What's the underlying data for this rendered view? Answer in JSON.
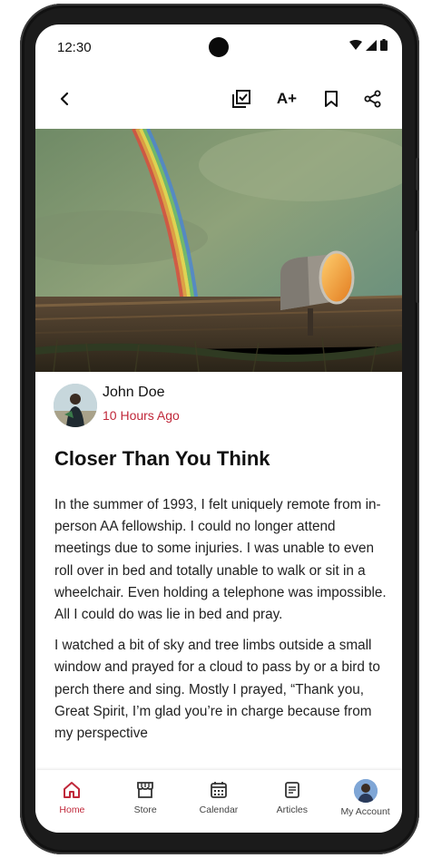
{
  "status_bar": {
    "time": "12:30",
    "icons": [
      "wifi-icon",
      "signal-icon",
      "battery-icon"
    ]
  },
  "toolbar": {
    "back_icon": "chevron-left-icon",
    "actions": [
      "checklist-icon",
      "text-size-icon",
      "bookmark-icon",
      "share-icon"
    ],
    "text_size_label": "A+"
  },
  "hero_image": {
    "description_icon": "rainbow-mailbox-image"
  },
  "author": {
    "name": "John Doe",
    "time": "10 Hours Ago"
  },
  "article": {
    "title": "Closer Than You Think",
    "paragraphs": [
      "In the summer of 1993, I felt uniquely remote from in-person AA fellowship. I could no longer attend meetings due to some injuries. I was unable to even roll over in bed and totally unable to walk or sit in a wheelchair. Even holding a telephone was impossible. All I could do was lie in bed and pray.",
      "I watched a bit of sky and tree limbs outside a small window and prayed for a cloud to pass by or a bird to perch there and sing. Mostly I prayed, “Thank you, Great Spirit, I’m glad you’re in charge because from my perspective"
    ]
  },
  "bottom_nav": {
    "items": [
      {
        "label": "Home",
        "icon": "home-icon",
        "active": true
      },
      {
        "label": "Store",
        "icon": "store-icon",
        "active": false
      },
      {
        "label": "Calendar",
        "icon": "calendar-icon",
        "active": false
      },
      {
        "label": "Articles",
        "icon": "articles-icon",
        "active": false
      },
      {
        "label": "My Account",
        "icon": "account-avatar",
        "active": false
      }
    ]
  },
  "colors": {
    "accent": "#c0283a",
    "text": "#111111",
    "device_frame": "#1b1b1b"
  }
}
